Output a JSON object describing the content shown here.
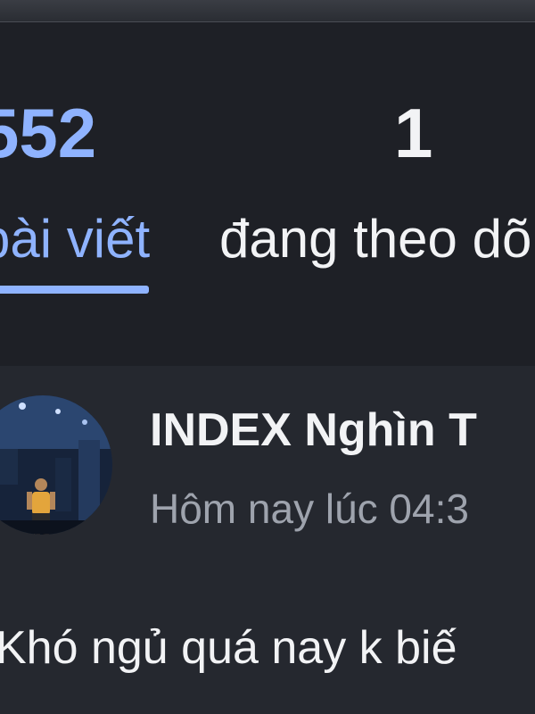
{
  "profile_stats": {
    "posts": {
      "count": "552",
      "label": "bài viết"
    },
    "following": {
      "count": "1",
      "label": "đang theo dõi"
    }
  },
  "post": {
    "author": "INDEX Nghìn T",
    "timestamp": "Hôm nay lúc 04:3",
    "text": "Khó ngủ quá nay k biế"
  }
}
